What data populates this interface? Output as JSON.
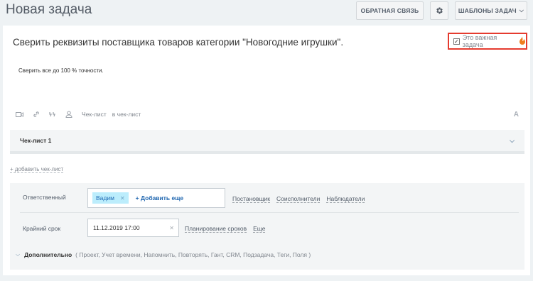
{
  "header": {
    "title": "Новая задача",
    "feedback_label": "ОБРАТНАЯ СВЯЗЬ",
    "templates_label": "ШАБЛОНЫ ЗАДАЧ"
  },
  "task": {
    "title": "Сверить реквизиты поставщика товаров категории \"Новогодние игрушки\".",
    "important_label": "Это важная задача",
    "important_checked": true,
    "description": "Сверить все до 100 % точности."
  },
  "toolbar": {
    "checklist_label": "Чек-лист",
    "to_checklist_label": "в чек-лист",
    "font_label": "A"
  },
  "checklist": {
    "title": "Чек-лист 1",
    "add_label": "+ добавить чек-лист"
  },
  "details": {
    "responsible_label": "Ответственный",
    "responsible_user": "Вадим",
    "add_more_label": "+ Добавить еще",
    "role_links": [
      "Постановщик",
      "Соисполнители",
      "Наблюдатели"
    ],
    "deadline_label": "Крайний срок",
    "deadline_value": "11.12.2019 17:00",
    "deadline_links": [
      "Планирование сроков",
      "Еще"
    ],
    "extra_label": "Дополнительно",
    "extra_list": "( Проект, Учет времени, Напомнить, Повторять, Гант, CRM, Подзадача, Теги, Поля )"
  },
  "colors": {
    "accent_link": "#2067b0",
    "important_border": "#e53b2f",
    "chip_bg": "#bcedfc"
  }
}
